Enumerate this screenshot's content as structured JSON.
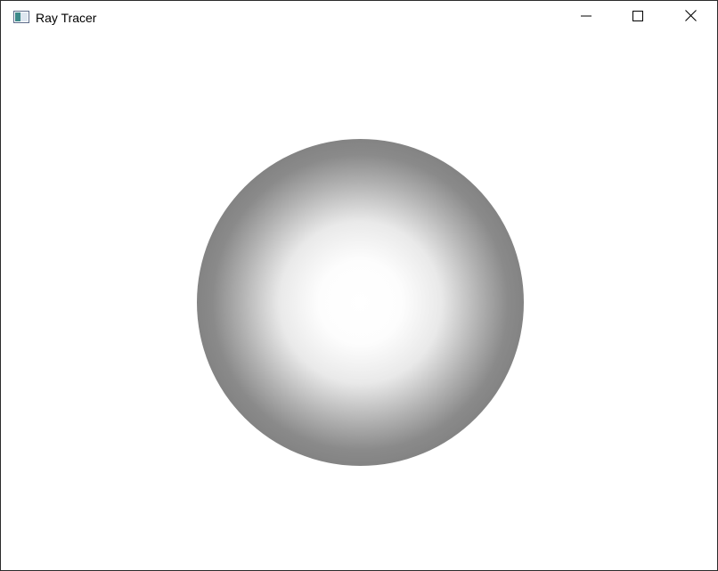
{
  "window": {
    "title": "Ray Tracer"
  },
  "icons": {
    "app": "app-icon",
    "minimize": "minimize-icon",
    "maximize": "maximize-icon",
    "close": "close-icon"
  },
  "scene": {
    "object": "sphere",
    "colors": {
      "highlight": "#ffffff",
      "midtone": "#7c7c7c",
      "edge": "#5a5a5a",
      "background": "#ffffff"
    }
  }
}
